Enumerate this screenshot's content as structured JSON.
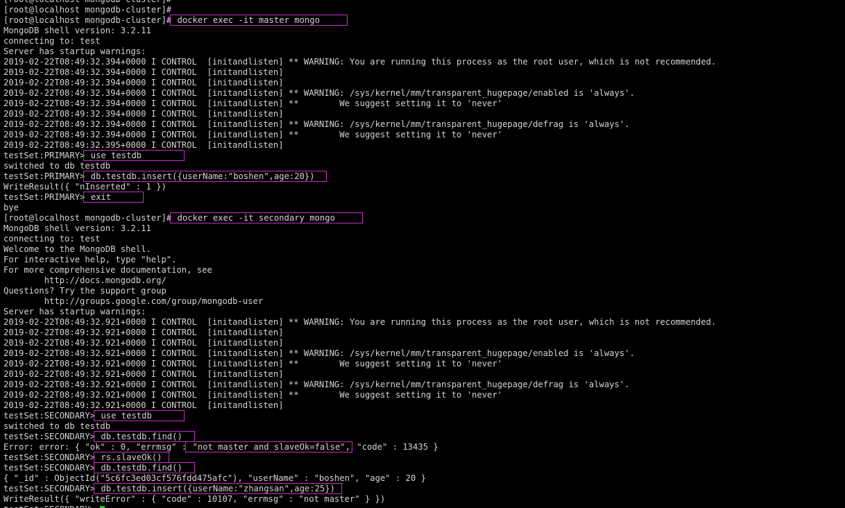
{
  "theme": {
    "background": "#000000",
    "foreground": "#d4d4d4",
    "highlight_box": "#c82fc8",
    "cursor": "#19c619"
  },
  "lines": [
    {
      "text": "[root@localhost mongodb-cluster]#"
    },
    {
      "text": "[root@localhost mongodb-cluster]#"
    },
    {
      "text": "[root@localhost mongodb-cluster]#",
      "hl": " docker exec -it master mongo     "
    },
    {
      "text": "MongoDB shell version: 3.2.11"
    },
    {
      "text": "connecting to: test"
    },
    {
      "text": "Server has startup warnings:"
    },
    {
      "text": "2019-02-22T08:49:32.394+0000 I CONTROL  [initandlisten] ** WARNING: You are running this process as the root user, which is not recommended."
    },
    {
      "text": "2019-02-22T08:49:32.394+0000 I CONTROL  [initandlisten]"
    },
    {
      "text": "2019-02-22T08:49:32.394+0000 I CONTROL  [initandlisten]"
    },
    {
      "text": "2019-02-22T08:49:32.394+0000 I CONTROL  [initandlisten] ** WARNING: /sys/kernel/mm/transparent_hugepage/enabled is 'always'."
    },
    {
      "text": "2019-02-22T08:49:32.394+0000 I CONTROL  [initandlisten] **        We suggest setting it to 'never'"
    },
    {
      "text": "2019-02-22T08:49:32.394+0000 I CONTROL  [initandlisten]"
    },
    {
      "text": "2019-02-22T08:49:32.394+0000 I CONTROL  [initandlisten] ** WARNING: /sys/kernel/mm/transparent_hugepage/defrag is 'always'."
    },
    {
      "text": "2019-02-22T08:49:32.394+0000 I CONTROL  [initandlisten] **        We suggest setting it to 'never'"
    },
    {
      "text": "2019-02-22T08:49:32.395+0000 I CONTROL  [initandlisten]"
    },
    {
      "text": "testSet:PRIMARY>",
      "hl": " use testdb        "
    },
    {
      "text": "switched to db testdb"
    },
    {
      "text": "testSet:PRIMARY>",
      "hl": " db.testdb.insert({userName:\"boshen\",age:20})  "
    },
    {
      "text": "WriteResult({ \"nInserted\" : 1 })"
    },
    {
      "text": "testSet:PRIMARY>",
      "hl": " exit      "
    },
    {
      "text": "bye"
    },
    {
      "text": "[root@localhost mongodb-cluster]#",
      "hl": " docker exec -it secondary mongo     "
    },
    {
      "text": "MongoDB shell version: 3.2.11"
    },
    {
      "text": "connecting to: test"
    },
    {
      "text": "Welcome to the MongoDB shell."
    },
    {
      "text": "For interactive help, type \"help\"."
    },
    {
      "text": "For more comprehensive documentation, see"
    },
    {
      "text": "        http://docs.mongodb.org/"
    },
    {
      "text": "Questions? Try the support group"
    },
    {
      "text": "        http://groups.google.com/group/mongodb-user"
    },
    {
      "text": "Server has startup warnings:"
    },
    {
      "text": "2019-02-22T08:49:32.921+0000 I CONTROL  [initandlisten] ** WARNING: You are running this process as the root user, which is not recommended."
    },
    {
      "text": "2019-02-22T08:49:32.921+0000 I CONTROL  [initandlisten]"
    },
    {
      "text": "2019-02-22T08:49:32.921+0000 I CONTROL  [initandlisten]"
    },
    {
      "text": "2019-02-22T08:49:32.921+0000 I CONTROL  [initandlisten] ** WARNING: /sys/kernel/mm/transparent_hugepage/enabled is 'always'."
    },
    {
      "text": "2019-02-22T08:49:32.921+0000 I CONTROL  [initandlisten] **        We suggest setting it to 'never'"
    },
    {
      "text": "2019-02-22T08:49:32.921+0000 I CONTROL  [initandlisten]"
    },
    {
      "text": "2019-02-22T08:49:32.921+0000 I CONTROL  [initandlisten] ** WARNING: /sys/kernel/mm/transparent_hugepage/defrag is 'always'."
    },
    {
      "text": "2019-02-22T08:49:32.921+0000 I CONTROL  [initandlisten] **        We suggest setting it to 'never'"
    },
    {
      "text": "2019-02-22T08:49:32.921+0000 I CONTROL  [initandlisten]"
    },
    {
      "text": "testSet:SECONDARY>",
      "hl": " use testdb      "
    },
    {
      "text": "switched to db testdb"
    },
    {
      "text": "testSet:SECONDARY>",
      "hl": " db.testdb.find()  "
    },
    {
      "text": "Error: error: { \"ok\" : 0, \"errmsg\" :",
      "hl": " \"not master and slaveOk=false\",",
      "after": " \"code\" : 13435 }"
    },
    {
      "text": "testSet:SECONDARY>",
      "hl": " rs.slaveOk() "
    },
    {
      "text": "testSet:SECONDARY>",
      "hl": " db.testdb.find()  "
    },
    {
      "text": "{ \"_id\" : ObjectId(\"5c6fc3ed03cf576fdd475afc\"), \"userName\" : \"boshen\", \"age\" : 20 }"
    },
    {
      "text": "testSet:SECONDARY>",
      "hl": " db.testdb.insert({userName:\"zhangsan\",age:25}) "
    },
    {
      "text": "WriteResult({ \"writeError\" : { \"code\" : 10107, \"errmsg\" : \"not master\" } })"
    },
    {
      "text": "testSet:SECONDARY>",
      "cursor": true
    }
  ]
}
